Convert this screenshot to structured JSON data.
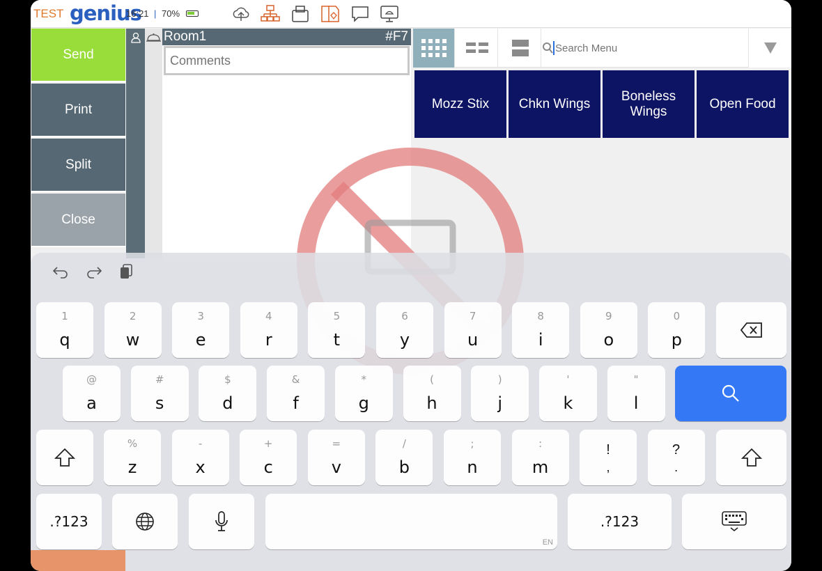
{
  "status_bar": {
    "env_label": "TEST",
    "logo_text": "genius",
    "time": "16:21",
    "separator": "|",
    "battery": "70%"
  },
  "toolbar_icons": [
    "cloud-upload-icon",
    "network-icon",
    "printer-icon",
    "kitchen-doc-icon",
    "chat-icon",
    "kitchen-display-icon"
  ],
  "side_buttons": {
    "send": "Send",
    "print": "Print",
    "split": "Split",
    "close": "Close"
  },
  "order": {
    "room": "Room1",
    "order_number": "#F7",
    "comments_placeholder": "Comments"
  },
  "menu": {
    "search_placeholder": "Search Menu",
    "items": [
      "Mozz Stix",
      "Chkn Wings",
      "Boneless Wings",
      "Open Food"
    ]
  },
  "colors": {
    "send": "#99dd3a",
    "button_dark": "#566873",
    "menu_item": "#0e1464",
    "search_key": "#3478f6"
  },
  "keyboard": {
    "row1": [
      {
        "alt": "1",
        "main": "q"
      },
      {
        "alt": "2",
        "main": "w"
      },
      {
        "alt": "3",
        "main": "e"
      },
      {
        "alt": "4",
        "main": "r"
      },
      {
        "alt": "5",
        "main": "t"
      },
      {
        "alt": "6",
        "main": "y"
      },
      {
        "alt": "7",
        "main": "u"
      },
      {
        "alt": "8",
        "main": "i"
      },
      {
        "alt": "9",
        "main": "o"
      },
      {
        "alt": "0",
        "main": "p"
      }
    ],
    "row2": [
      {
        "alt": "@",
        "main": "a"
      },
      {
        "alt": "#",
        "main": "s"
      },
      {
        "alt": "$",
        "main": "d"
      },
      {
        "alt": "&",
        "main": "f"
      },
      {
        "alt": "*",
        "main": "g"
      },
      {
        "alt": "(",
        "main": "h"
      },
      {
        "alt": ")",
        "main": "j"
      },
      {
        "alt": "'",
        "main": "k"
      },
      {
        "alt": "\"",
        "main": "l"
      }
    ],
    "row3": [
      {
        "alt": "%",
        "main": "z"
      },
      {
        "alt": "-",
        "main": "x"
      },
      {
        "alt": "+",
        "main": "c"
      },
      {
        "alt": "=",
        "main": "v"
      },
      {
        "alt": "/",
        "main": "b"
      },
      {
        "alt": ";",
        "main": "n"
      },
      {
        "alt": ":",
        "main": "m"
      }
    ],
    "punct1": {
      "top": "!",
      "bot": ","
    },
    "punct2": {
      "top": "?",
      "bot": "."
    },
    "num_label": ".?123",
    "num_label_right": ".?123",
    "space_lang": "EN"
  }
}
